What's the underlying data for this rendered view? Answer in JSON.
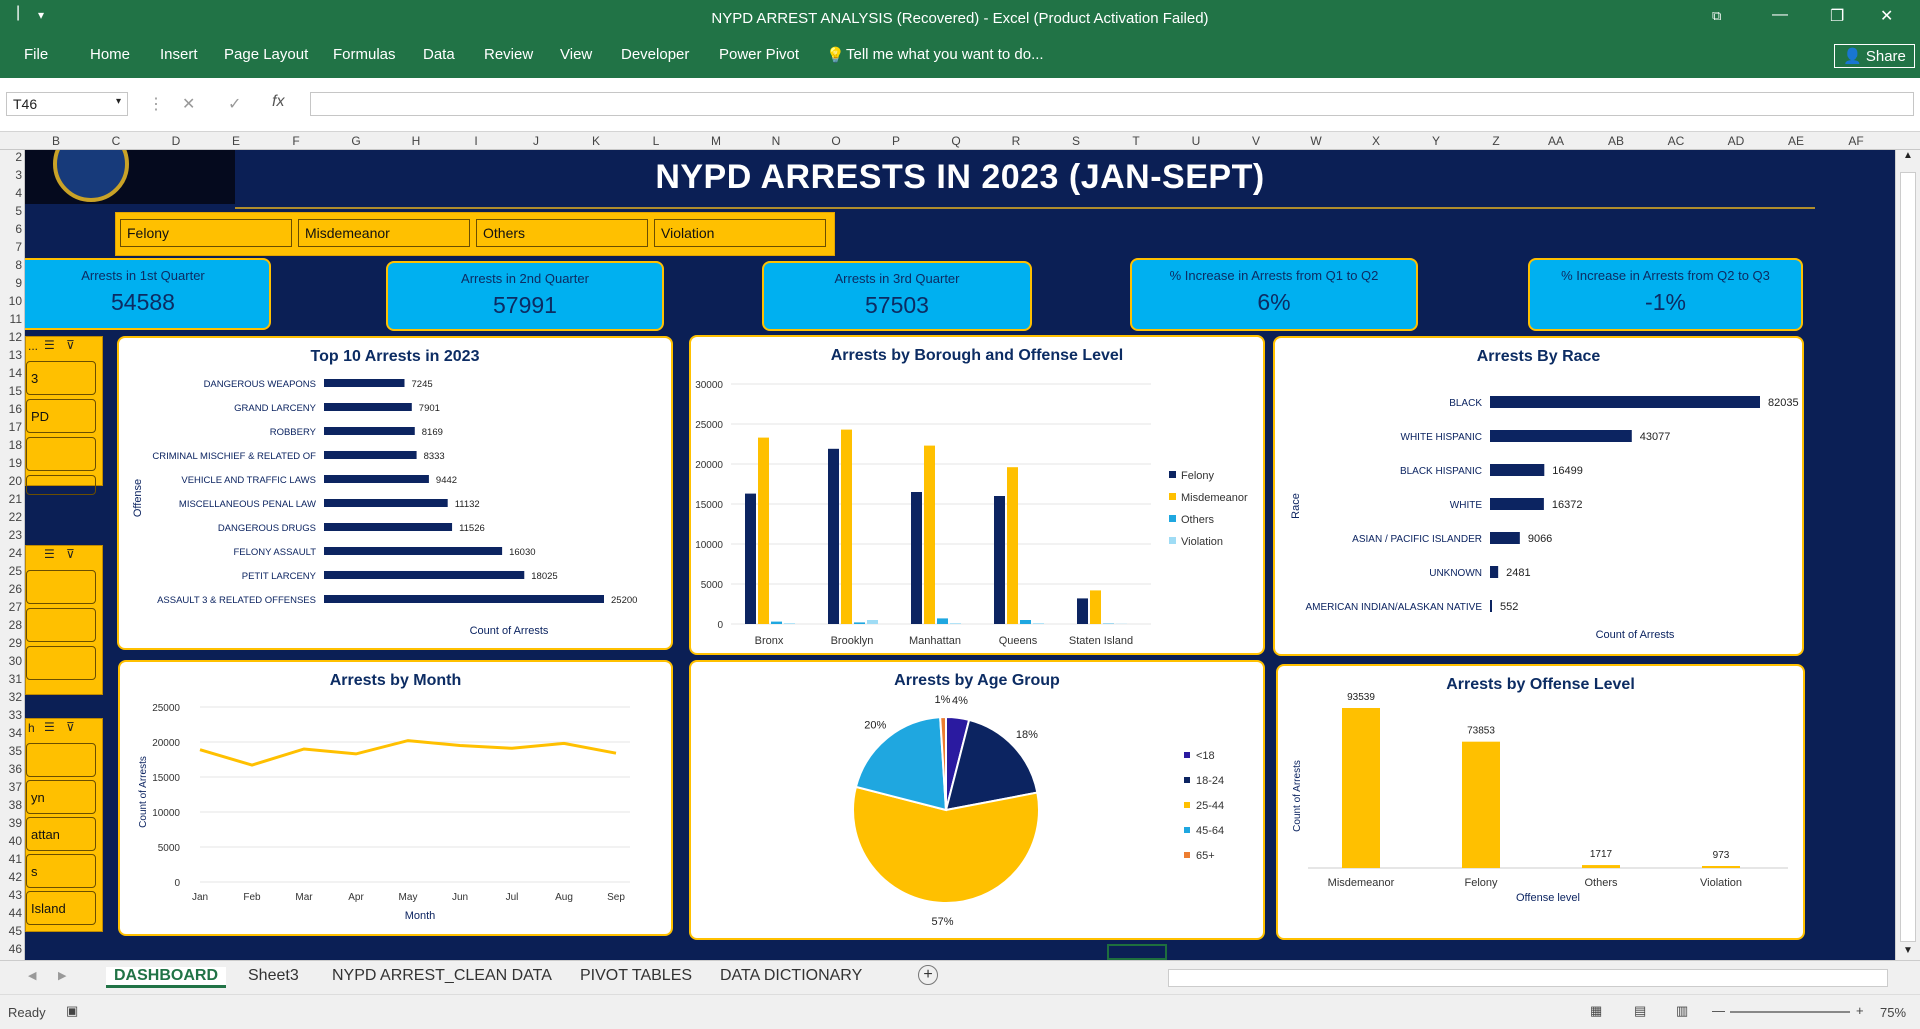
{
  "window": {
    "title": "NYPD ARREST ANALYSIS (Recovered) - Excel (Product Activation Failed)",
    "share": "Share"
  },
  "ribbon": {
    "tabs": [
      "File",
      "Home",
      "Insert",
      "Page Layout",
      "Formulas",
      "Data",
      "Review",
      "View",
      "Developer",
      "Power Pivot"
    ],
    "tell_me": "Tell me what you want to do..."
  },
  "formula_bar": {
    "name_box": "T46",
    "fx": "fx",
    "value": ""
  },
  "columns": [
    "B",
    "C",
    "D",
    "E",
    "F",
    "G",
    "H",
    "I",
    "J",
    "K",
    "L",
    "M",
    "N",
    "O",
    "P",
    "Q",
    "R",
    "S",
    "T",
    "U",
    "V",
    "W",
    "X",
    "Y",
    "Z",
    "AA",
    "AB",
    "AC",
    "AD",
    "AE",
    "AF"
  ],
  "rows": [
    "2",
    "3",
    "4",
    "5",
    "6",
    "7",
    "8",
    "9",
    "10",
    "11",
    "12",
    "13",
    "14",
    "15",
    "16",
    "17",
    "18",
    "19",
    "20",
    "21",
    "22",
    "23",
    "24",
    "25",
    "26",
    "27",
    "28",
    "29",
    "30",
    "31",
    "32",
    "33",
    "34",
    "35",
    "36",
    "37",
    "38",
    "39",
    "40",
    "41",
    "42",
    "43",
    "44",
    "45",
    "46"
  ],
  "dashboard": {
    "title": "NYPD ARRESTS IN 2023 (JAN-SEPT)",
    "slicer_offense": [
      "Felony",
      "Misdemeanor",
      "Others",
      "Violation"
    ],
    "side_slicer_1": [
      "3",
      "PD",
      "",
      ""
    ],
    "side_slicer_2": [
      "",
      "",
      ""
    ],
    "side_slicer_3": [
      "",
      "yn",
      "attan",
      "s",
      "Island"
    ],
    "side_headers": [
      "...",
      "",
      "h"
    ],
    "kpis": [
      {
        "label": "Arrests in 1st Quarter",
        "value": "54588"
      },
      {
        "label": "Arrests in 2nd Quarter",
        "value": "57991"
      },
      {
        "label": "Arrests in 3rd Quarter",
        "value": "57503"
      },
      {
        "label": "% Increase in Arrests from Q1 to Q2",
        "value": "6%"
      },
      {
        "label": "% Increase in Arrests from Q2 to Q3",
        "value": "-1%"
      }
    ]
  },
  "chart_data": [
    {
      "type": "bar",
      "title": "Top 10 Arrests in 2023",
      "ylabel": "Offense",
      "xlabel": "Count of Arrests",
      "orientation": "horizontal",
      "color": "#0c2461",
      "categories": [
        "DANGEROUS WEAPONS",
        "GRAND LARCENY",
        "ROBBERY",
        "CRIMINAL MISCHIEF & RELATED OF",
        "VEHICLE AND TRAFFIC LAWS",
        "MISCELLANEOUS PENAL LAW",
        "DANGEROUS DRUGS",
        "FELONY ASSAULT",
        "PETIT LARCENY",
        "ASSAULT 3 & RELATED OFFENSES"
      ],
      "values": [
        7245,
        7901,
        8169,
        8333,
        9442,
        11132,
        11526,
        16030,
        18025,
        25200
      ]
    },
    {
      "type": "bar",
      "title": "Arrests by Borough and Offense Level",
      "categories": [
        "Bronx",
        "Brooklyn",
        "Manhattan",
        "Queens",
        "Staten Island"
      ],
      "ylim": [
        0,
        30000
      ],
      "yticks": [
        "30000",
        "25000",
        "20000",
        "15000",
        "10000",
        "5000",
        "0"
      ],
      "series": [
        {
          "name": "Felony",
          "color": "#0c2461",
          "values": [
            16300,
            21900,
            16500,
            16000,
            3200
          ]
        },
        {
          "name": "Misdemeanor",
          "color": "#ffc000",
          "values": [
            23300,
            24300,
            22300,
            19600,
            4200
          ]
        },
        {
          "name": "Others",
          "color": "#1fa7e0",
          "values": [
            300,
            200,
            700,
            500,
            50
          ]
        },
        {
          "name": "Violation",
          "color": "#9fdcf5",
          "values": [
            100,
            500,
            100,
            100,
            30
          ]
        }
      ]
    },
    {
      "type": "bar",
      "title": "Arrests By Race",
      "ylabel": "Race",
      "xlabel": "Count of Arrests",
      "orientation": "horizontal",
      "color": "#0c2461",
      "categories": [
        "BLACK",
        "WHITE HISPANIC",
        "BLACK HISPANIC",
        "WHITE",
        "ASIAN / PACIFIC ISLANDER",
        "UNKNOWN",
        "AMERICAN INDIAN/ALASKAN NATIVE"
      ],
      "values": [
        82035,
        43077,
        16499,
        16372,
        9066,
        2481,
        552
      ]
    },
    {
      "type": "line",
      "title": "Arrests by Month",
      "xlabel": "Month",
      "ylabel": "Count of Arrests",
      "ylim": [
        0,
        25000
      ],
      "yticks": [
        "25000",
        "20000",
        "15000",
        "10000",
        "5000",
        "0"
      ],
      "color": "#ffc000",
      "categories": [
        "Jan",
        "Feb",
        "Mar",
        "Apr",
        "May",
        "Jun",
        "Jul",
        "Aug",
        "Sep"
      ],
      "values": [
        18900,
        16700,
        19000,
        18300,
        20200,
        19500,
        19100,
        19800,
        18400
      ]
    },
    {
      "type": "pie",
      "title": "Arrests by Age Group",
      "categories": [
        "<18",
        "18-24",
        "25-44",
        "45-64",
        "65+"
      ],
      "values": [
        4,
        18,
        57,
        20,
        1
      ],
      "labels": [
        "4%",
        "18%",
        "57%",
        "20%",
        "1%"
      ],
      "colors": [
        "#2a1aa0",
        "#0c2461",
        "#ffc000",
        "#1fa7e0",
        "#ed7d31"
      ]
    },
    {
      "type": "bar",
      "title": "Arrests by Offense Level",
      "xlabel": "Offense level",
      "ylabel": "Count of Arrests",
      "color": "#ffc000",
      "categories": [
        "Misdemeanor",
        "Felony",
        "Others",
        "Violation"
      ],
      "values": [
        93539,
        73853,
        1717,
        973
      ]
    }
  ],
  "sheet_tabs": [
    "DASHBOARD",
    "Sheet3",
    "NYPD ARREST_CLEAN DATA",
    "PIVOT TABLES",
    "DATA DICTIONARY"
  ],
  "status": {
    "ready": "Ready",
    "zoom": "75%"
  }
}
